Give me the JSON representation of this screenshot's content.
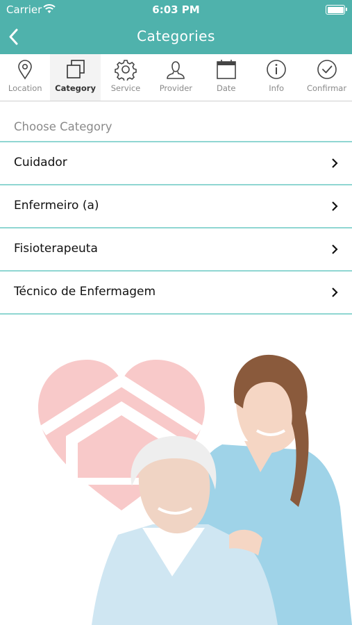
{
  "status_bar": {
    "carrier": "Carrier",
    "time": "6:03 PM"
  },
  "nav": {
    "title": "Categories"
  },
  "steps": [
    {
      "label": "Location",
      "icon": "location-pin-icon"
    },
    {
      "label": "Category",
      "icon": "category-squares-icon",
      "active": true
    },
    {
      "label": "Service",
      "icon": "gear-icon"
    },
    {
      "label": "Provider",
      "icon": "person-icon"
    },
    {
      "label": "Date",
      "icon": "calendar-icon"
    },
    {
      "label": "Info",
      "icon": "info-icon"
    },
    {
      "label": "Confirmar",
      "icon": "check-circle-icon"
    }
  ],
  "section": {
    "title": "Choose Category"
  },
  "categories": [
    {
      "label": "Cuidador"
    },
    {
      "label": "Enfermeiro (a)"
    },
    {
      "label": "Fisioterapeuta"
    },
    {
      "label": "Técnico de Enfermagem"
    }
  ],
  "colors": {
    "header": "#4fb2ac",
    "divider": "#8fd6d2",
    "heart": "#f8c9c9",
    "scrub": "#9fd3e8"
  }
}
